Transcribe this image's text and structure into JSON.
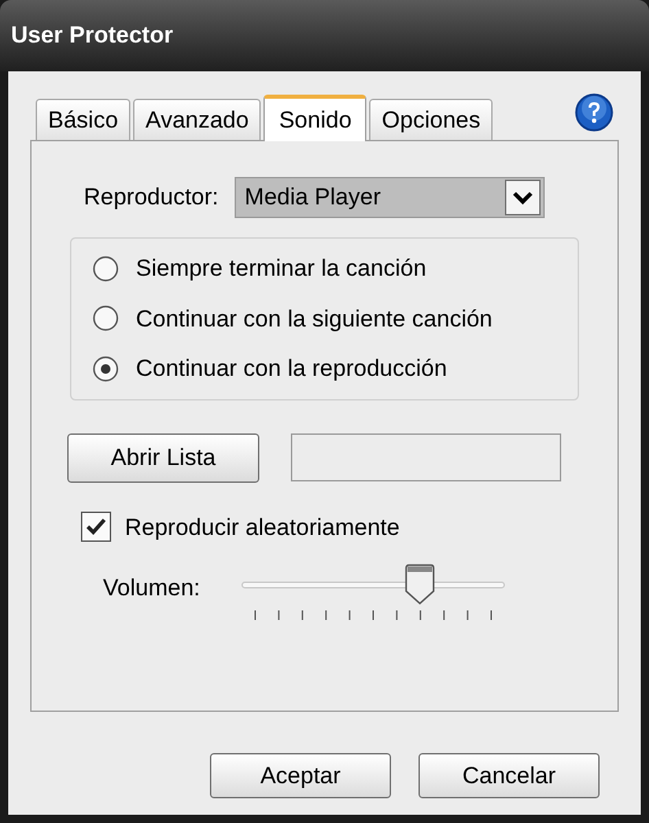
{
  "window": {
    "title": "User Protector"
  },
  "tabs": [
    {
      "label": "Básico",
      "selected": false
    },
    {
      "label": "Avanzado",
      "selected": false
    },
    {
      "label": "Sonido",
      "selected": true
    },
    {
      "label": "Opciones",
      "selected": false
    }
  ],
  "player": {
    "label": "Reproductor:",
    "value": "Media Player"
  },
  "options": [
    {
      "label": "Siempre terminar la canción",
      "selected": false
    },
    {
      "label": "Continuar con la siguiente canción",
      "selected": false
    },
    {
      "label": "Continuar con la reproducción",
      "selected": true
    }
  ],
  "open_list": {
    "label": "Abrir Lista"
  },
  "shuffle": {
    "label": "Reproducir aleatoriamente",
    "checked": true
  },
  "volume": {
    "label": "Volumen:",
    "level": 0.68
  },
  "buttons": [
    "Aceptar",
    "Cancelar"
  ]
}
